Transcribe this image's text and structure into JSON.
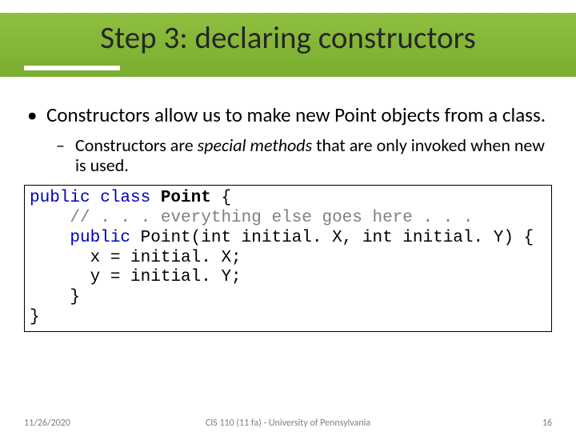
{
  "slide": {
    "title": "Step 3: declaring constructors",
    "bullets": {
      "main": "Constructors allow us to make new Point objects from a class.",
      "sub_prefix": "Constructors are ",
      "sub_italic": "special methods",
      "sub_suffix": " that are only invoked when new is used."
    },
    "code": {
      "l1_kw": "public class ",
      "l1_cls": "Point",
      "l1_rest": " {",
      "l2_cmt": "// . . . everything else goes here . . .",
      "l3_kw": "public ",
      "l3_rest": "Point(int initial. X, int initial. Y) {",
      "l4": "x = initial. X;",
      "l5": "y = initial. Y;",
      "l6": "}",
      "l7": "}"
    }
  },
  "footer": {
    "date": "11/26/2020",
    "center": "CIS 110 (11 fa) - University of Pennsylvania",
    "page": "16"
  }
}
